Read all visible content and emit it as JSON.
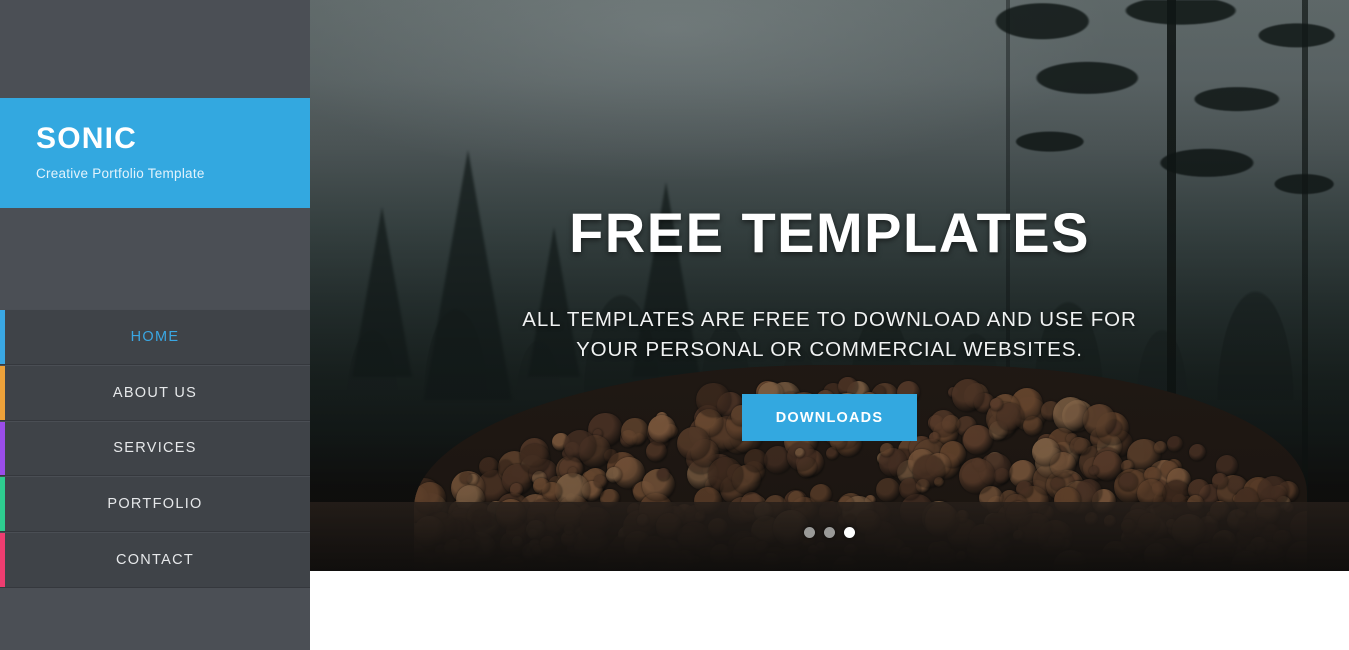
{
  "sidebar": {
    "logo": {
      "title": "SONIC",
      "tagline": "Creative Portfolio Template",
      "background_color": "#33a8e0"
    },
    "nav_items": [
      {
        "label": "HOME",
        "accent_color": "#3aa7e3",
        "active": true,
        "name": "sidebar-item-home"
      },
      {
        "label": "ABOUT US",
        "accent_color": "#eda13a",
        "active": false,
        "name": "sidebar-item-about-us"
      },
      {
        "label": "SERVICES",
        "accent_color": "#9b4dea",
        "active": false,
        "name": "sidebar-item-services"
      },
      {
        "label": "PORTFOLIO",
        "accent_color": "#2ecc8f",
        "active": false,
        "name": "sidebar-item-portfolio"
      },
      {
        "label": "CONTACT",
        "accent_color": "#ee3d70",
        "active": false,
        "name": "sidebar-item-contact"
      }
    ],
    "background_color": "#4b4f55"
  },
  "hero": {
    "heading": "FREE TEMPLATES",
    "subtitle": "ALL TEMPLATES ARE FREE TO DOWNLOAD AND USE FOR YOUR PERSONAL OR COMMERCIAL WEBSITES.",
    "button_label": "DOWNLOADS",
    "button_color": "#33a8e0",
    "image_description": "foggy pine forest with a large stacked pile of cut logs",
    "slider": {
      "total_dots": 3,
      "active_index": 3,
      "dots": [
        {
          "label": "slide-1",
          "active": false
        },
        {
          "label": "slide-2",
          "active": false
        },
        {
          "label": "slide-3",
          "active": true
        }
      ]
    }
  }
}
